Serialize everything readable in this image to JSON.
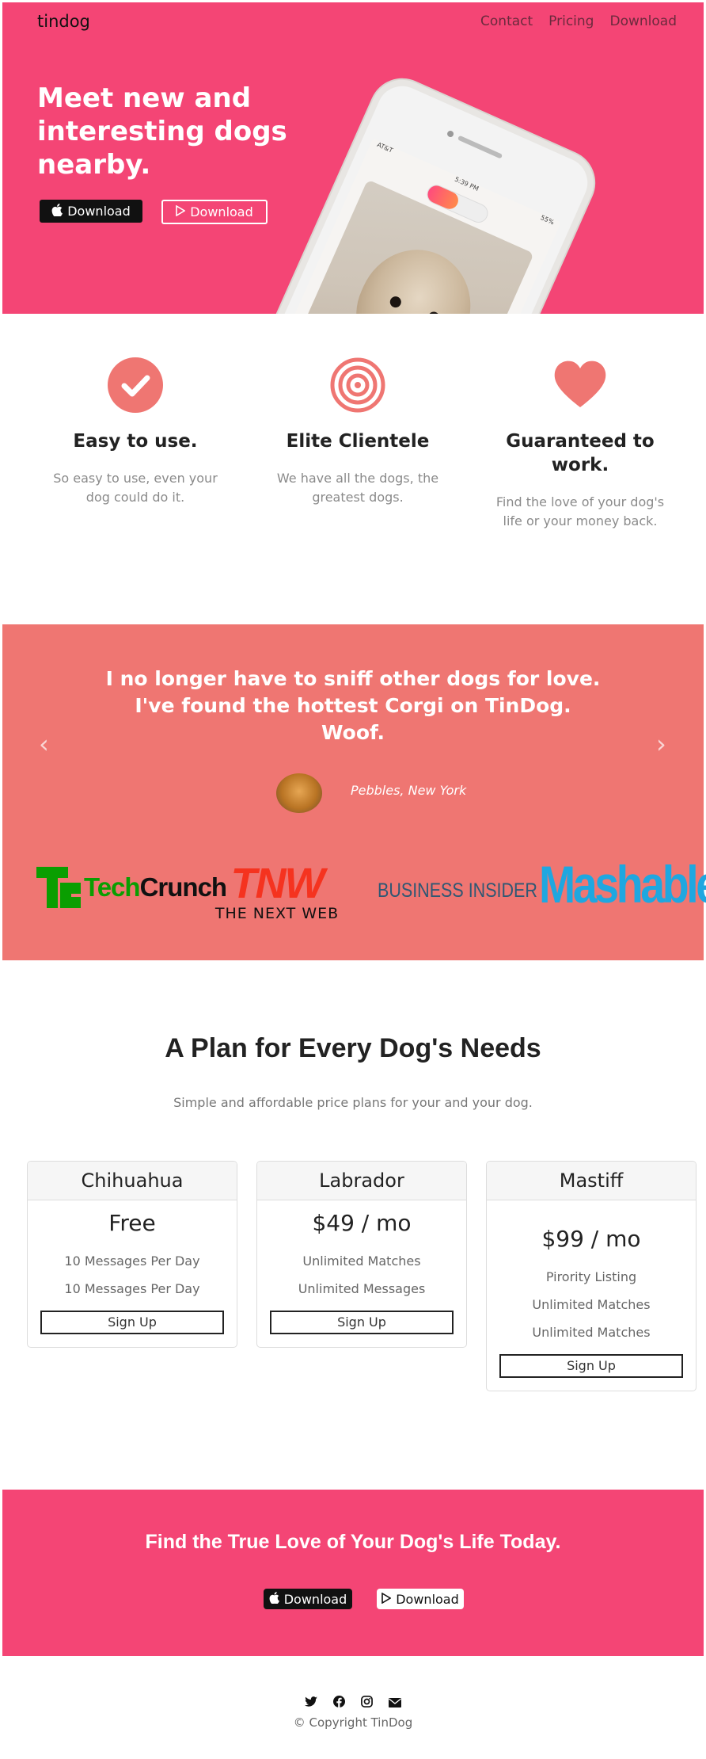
{
  "navbar": {
    "brand": "tindog",
    "links": [
      "Contact",
      "Pricing",
      "Download"
    ]
  },
  "hero": {
    "title": "Meet new and interesting dogs nearby.",
    "apple_button": "Download",
    "google_button": "Download",
    "phone_time": "5:39 PM",
    "phone_carrier": "AT&T",
    "phone_battery": "55%"
  },
  "features": [
    {
      "icon": "check-circle-icon",
      "title": "Easy to use.",
      "text": "So easy to use, even your dog could do it."
    },
    {
      "icon": "bullseye-icon",
      "title": "Elite Clientele",
      "text": "We have all the dogs, the greatest dogs."
    },
    {
      "icon": "heart-icon",
      "title": "Guaranteed to work.",
      "text": "Find the love of your dog's life or your money back."
    }
  ],
  "testimonial": {
    "quote": "I no longer have to sniff other dogs for love. I've found the hottest Corgi on TinDog. Woof.",
    "author": "Pebbles, New York"
  },
  "press": {
    "techcrunch": "TechCrunch",
    "tnw": "TNW",
    "tnw_sub": "THE NEXT WEB",
    "business_insider": "BUSINESS INSIDER",
    "mashable": "Mashable"
  },
  "pricing": {
    "title": "A Plan for Every Dog's Needs",
    "subtitle": "Simple and affordable price plans for your and your dog.",
    "plans": [
      {
        "name": "Chihuahua",
        "price": "Free",
        "features": [
          "10 Messages Per Day",
          "10 Messages Per Day"
        ],
        "button": "Sign Up"
      },
      {
        "name": "Labrador",
        "price": "$49 / mo",
        "features": [
          "Unlimited Matches",
          "Unlimited Messages"
        ],
        "button": "Sign Up"
      },
      {
        "name": "Mastiff",
        "price": "$99 / mo",
        "features": [
          "Pirority Listing",
          "Unlimited Matches",
          "Unlimited Matches"
        ],
        "button": "Sign Up"
      }
    ]
  },
  "cta": {
    "title": "Find the True Love of Your Dog's Life Today.",
    "apple_button": "Download",
    "google_button": "Download"
  },
  "footer": {
    "social_icons": [
      "twitter-icon",
      "facebook-icon",
      "instagram-icon",
      "envelope-icon"
    ],
    "copyright": "© Copyright TinDog"
  },
  "colors": {
    "primary": "#f44575",
    "testimonial_bg": "#ef7672",
    "feature_icon": "#ef7672"
  }
}
